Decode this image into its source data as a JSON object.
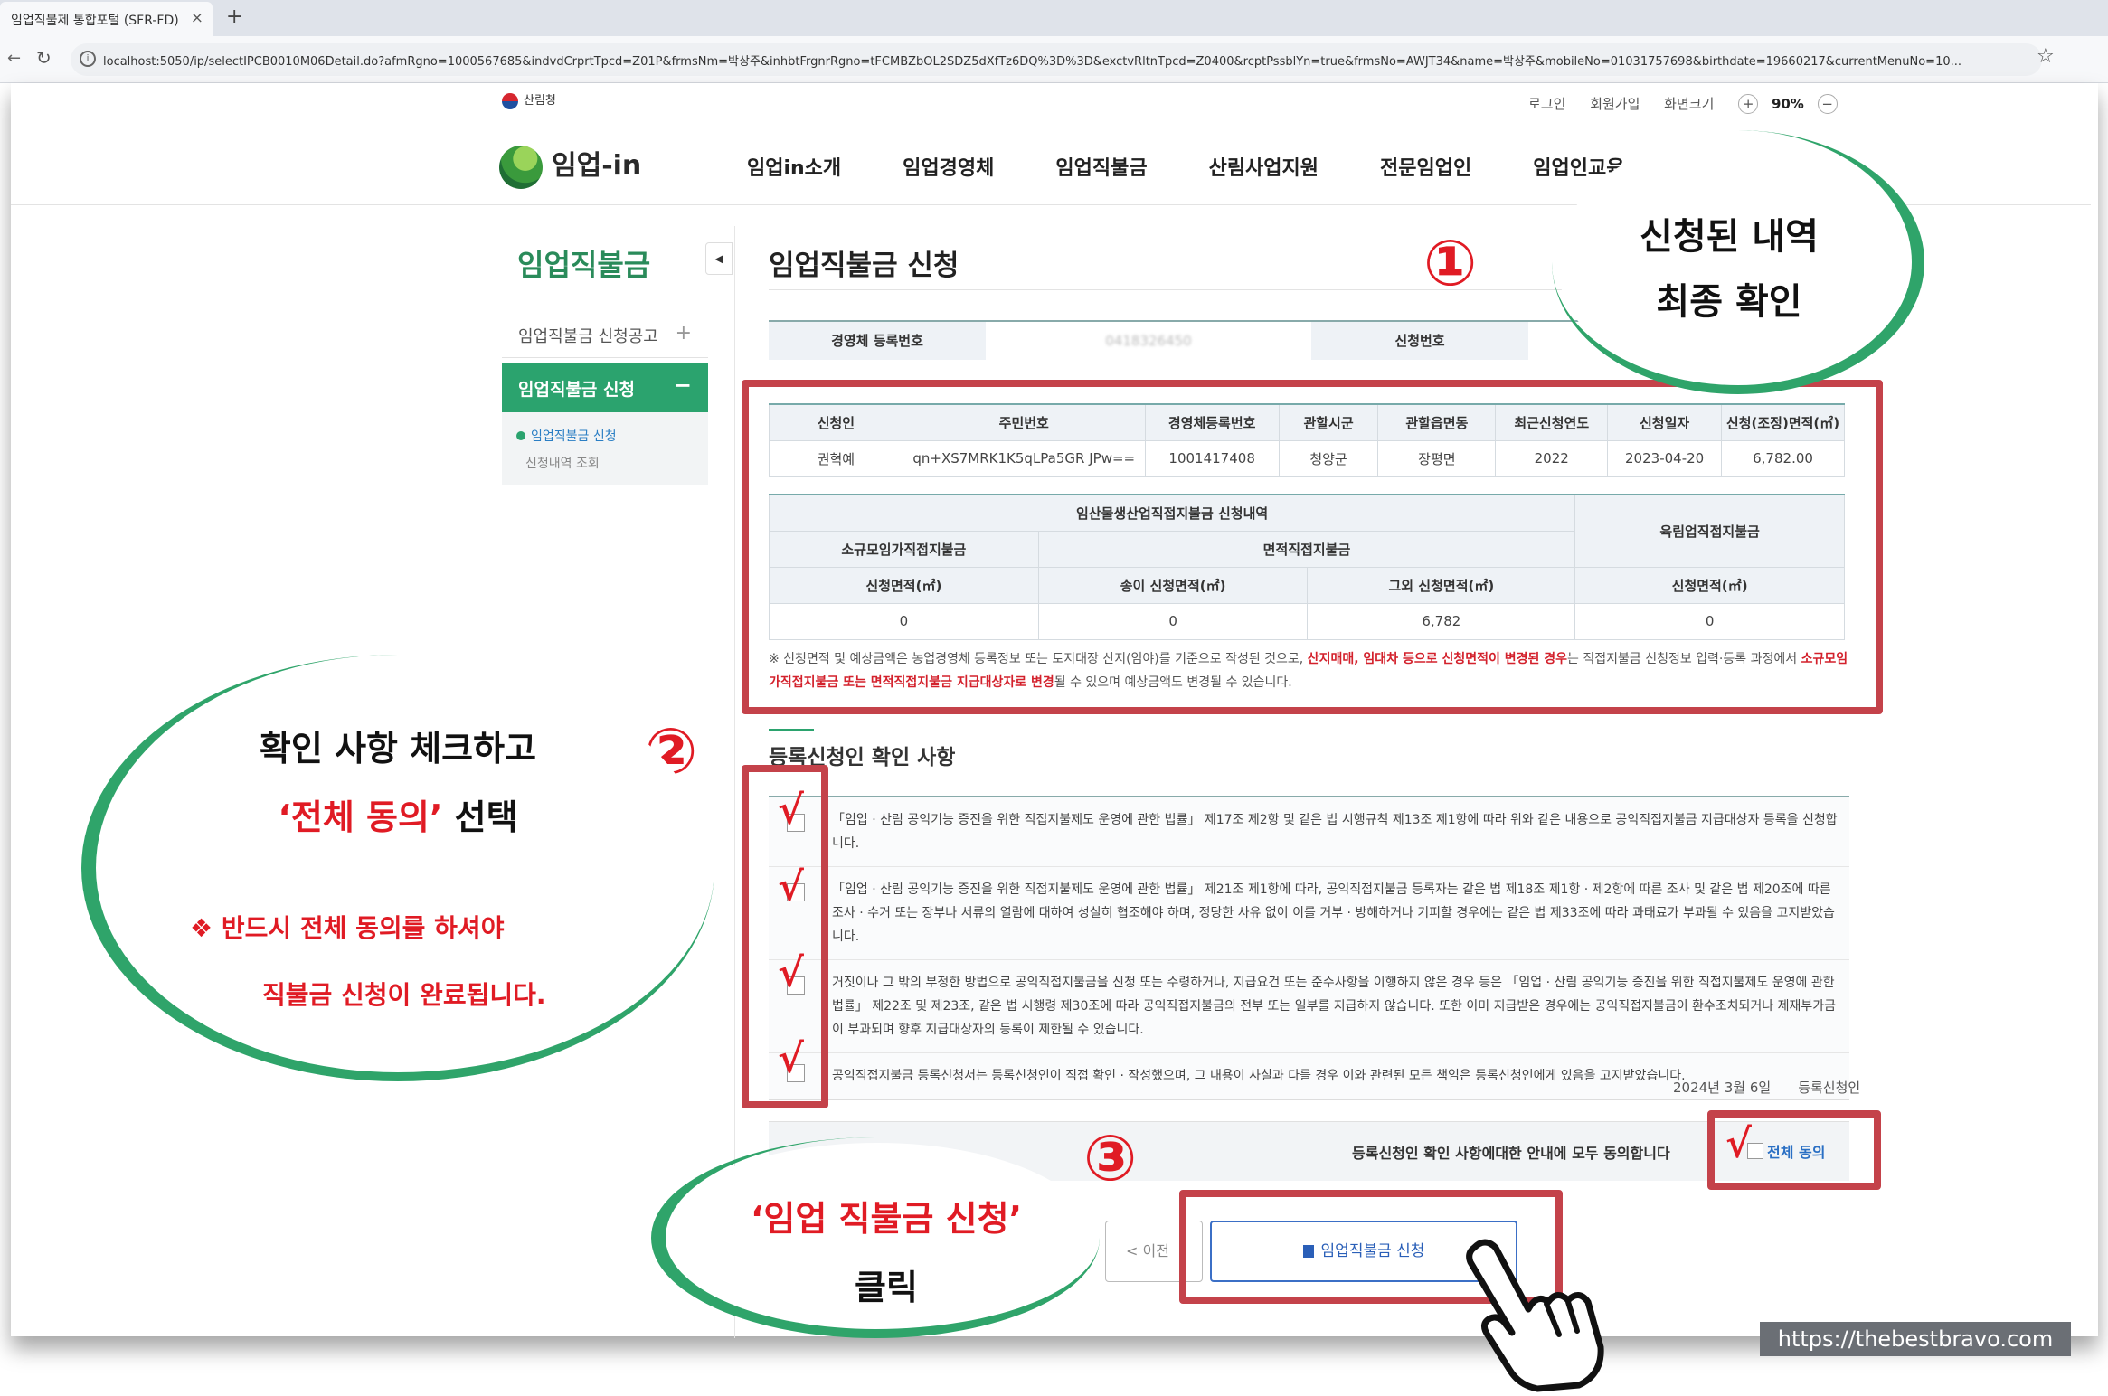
{
  "browser": {
    "tab_title": "임업직불제 통합포털 (SFR-FD)",
    "tab_close": "×",
    "new_tab": "+",
    "url": "localhost:5050/ip/selectIPCB0010M06Detail.do?afmRgno=1000567685&indvdCrprtTpcd=Z01P&frmsNm=박상주&inhbtFrgnrRgno=tFCMBZbOL2SDZ5dXfTz6DQ%3D%3D&exctvRltnTpcd=Z0400&rcptPssblYn=true&frmsNo=AWJT34&name=박상주&mobileNo=01031757698&birthdate=19660217&currentMenuNo=10..."
  },
  "util": {
    "gov": "산림청",
    "login": "로그인",
    "join": "회원가입",
    "zoom_label": "화면크기",
    "zoom_plus": "+",
    "zoom_value": "90%",
    "zoom_minus": "−"
  },
  "site": {
    "logo_text": "임업-in",
    "nav": [
      "임업in소개",
      "임업경영체",
      "임업직불금",
      "산림사업지원",
      "전문임업인",
      "임업인교육"
    ]
  },
  "sidebar": {
    "title": "임업직불금",
    "toggle": "◀",
    "item1": "임업직불금 신청공고",
    "item1_icon": "+",
    "item2": "임업직불금 신청",
    "item2_icon": "−",
    "sub1": "임업직불금 신청",
    "sub2": "신청내역 조회"
  },
  "main": {
    "title": "임업직불금 신청",
    "info_labels": [
      "경영체 등록번호",
      "신청번호"
    ],
    "info_values": [
      "0418326450",
      ""
    ],
    "table1": {
      "headers": [
        "신청인",
        "주민번호",
        "경영체등록번호",
        "관할시군",
        "관할읍면동",
        "최근신청연도",
        "신청일자",
        "신청(조정)면적(㎡)"
      ],
      "row": [
        "권혁예",
        "qn+XS7MRK1K5qLPa5GR JPw==",
        "1001417408",
        "청양군",
        "장평면",
        "2022",
        "2023-04-20",
        "6,782.00"
      ]
    },
    "table2": {
      "top_header": "임산물생산업직접지불금 신청내역",
      "right_header": "육림업직접지불금",
      "sub_left": "소규모임가직접지불금",
      "sub_mid": "면적직접지불금",
      "col_headers": [
        "신청면적(㎡)",
        "송이 신청면적(㎡)",
        "그외 신청면적(㎡)",
        "신청면적(㎡)"
      ],
      "values": [
        "0",
        "0",
        "6,782",
        "0"
      ]
    },
    "note": {
      "part1": "※ 신청면적 및 예상금액은 농업경영체 등록정보 또는 토지대장 산지(임야)를 기준으로 작성된 것으로, ",
      "red1": "산지매매, 임대차 등으로 신청면적이 변경된 경우",
      "part2": "는 직접지불금 신청정보 입력·등록 과정에서 ",
      "red2": "소규모임가직접지불금 또는 면적직접지불금 지급대상자로 변경",
      "part3": "될 수 있으며 예상금액도 변경될 수 있습니다."
    },
    "section_title": "등록신청인 확인 사항",
    "agree_items": [
      "「임업 · 산림 공익기능 증진을 위한 직접지불제도 운영에 관한 법률」 제17조 제2항 및 같은 법 시행규칙 제13조 제1항에 따라 위와 같은 내용으로 공익직접지불금 지급대상자 등록을 신청합니다.",
      "「임업 · 산림 공익기능 증진을 위한 직접지불제도 운영에 관한 법률」 제21조 제1항에 따라, 공익직접지불금 등록자는 같은 법 제18조 제1항 · 제2항에 따른 조사 및 같은 법 제20조에 따른 조사 · 수거 또는 장부나 서류의 열람에 대하여 성실히 협조해야 하며, 정당한 사유 없이 이를 거부 · 방해하거나 기피할 경우에는 같은 법 제33조에 따라 과태료가 부과될 수 있음을 고지받았습니다.",
      "거짓이나 그 밖의 부정한 방법으로 공익직접지불금을 신청 또는 수령하거나, 지급요건 또는 준수사항을 이행하지 않은 경우 등은 「임업 · 산림 공익기능 증진을 위한 직접지불제도 운영에 관한 법률」 제22조 및 제23조, 같은 법 시행령 제30조에 따라 공익직접지불금의 전부 또는 일부를 지급하지 않습니다. 또한 이미 지급받은 경우에는 공익직접지불금이 환수조치되거나 제재부가금이 부과되며 향후 지급대상자의 등록이 제한될 수 있습니다.",
      "공익직접지불금 등록신청서는 등록신청인이 직접 확인 · 작성했으며, 그 내용이 사실과 다를 경우 이와 관련된 모든 책임은 등록신청인에게 있음을 고지받았습니다."
    ],
    "check_mark": "√",
    "date": "2024년 3월 6일",
    "applicant_label": "등록신청인",
    "all_agree_text": "등록신청인 확인 사항에대한 안내에 모두 동의합니다",
    "all_agree_label": "전체 동의",
    "btn_prev": "< 이전",
    "btn_apply": "임업직불금 신청"
  },
  "annotations": {
    "num1": "①",
    "num2": "②",
    "num3": "③",
    "bubble1_line1": "신청된 내역",
    "bubble1_line2": "최종 확인",
    "bubble2_line1": "확인 사항 체크하고",
    "bubble2_line2_red": "‘전체 동의’",
    "bubble2_line2": " 선택",
    "bubble2_note1": "❖ 반드시 전체 동의를 하셔야",
    "bubble2_note2": "직불금 신청이 완료됩니다.",
    "bubble3_line1": "‘임업 직불금 신청’",
    "bubble3_line2": "클릭"
  },
  "watermark": "https://thebestbravo.com",
  "colors": {
    "accent_green": "#2ba36e",
    "highlight_red": "#c4424a",
    "annotation_red": "#e01b24",
    "link_blue": "#2a6fc4"
  }
}
